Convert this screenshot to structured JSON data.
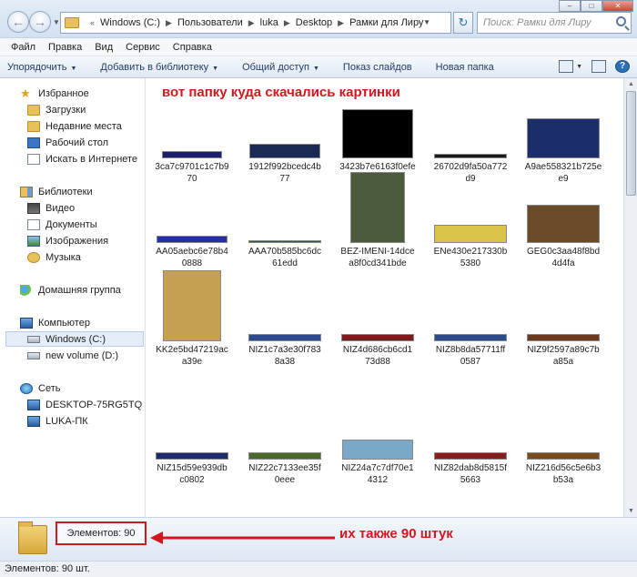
{
  "window": {
    "minimize": "–",
    "maximize": "□",
    "close": "✕"
  },
  "address": {
    "crumbs": [
      "Windows (C:)",
      "Пользователи",
      "luka",
      "Desktop",
      "Рамки для Лиру"
    ],
    "search_placeholder": "Поиск: Рамки для Лиру"
  },
  "menu": [
    "Файл",
    "Правка",
    "Вид",
    "Сервис",
    "Справка"
  ],
  "toolbar": {
    "organize": "Упорядочить",
    "add_library": "Добавить в библиотеку",
    "share": "Общий доступ",
    "slideshow": "Показ слайдов",
    "new_folder": "Новая папка"
  },
  "sidebar": {
    "favorites": "Избранное",
    "favorites_items": [
      "Загрузки",
      "Недавние места",
      "Рабочий стол",
      "Искать в Интернете"
    ],
    "libraries": "Библиотеки",
    "libraries_items": [
      "Видео",
      "Документы",
      "Изображения",
      "Музыка"
    ],
    "homegroup": "Домашняя группа",
    "computer": "Компьютер",
    "computer_items": [
      "Windows (C:)",
      "new volume (D:)"
    ],
    "network": "Сеть",
    "network_items": [
      "DESKTOP-75RG5TQ",
      "LUKA-ПК"
    ]
  },
  "annotation_top": "вот папку куда скачались картинки",
  "files": [
    {
      "l1": "3ca7c9701c1c7b9",
      "l2": "70",
      "color": "#1b1f6e"
    },
    {
      "l1": "1912f992bcedc4b",
      "l2": "77",
      "color": "#1a2a55"
    },
    {
      "l1": "3423b7e6163f0efe",
      "l2": "d",
      "color": "#000000"
    },
    {
      "l1": "26702d9fa50a772",
      "l2": "d9",
      "color": "#1a1a1a"
    },
    {
      "l1": "A9ae558321b725e",
      "l2": "e9",
      "color": "#1c2d6b"
    },
    {
      "l1": "AA05aebc6e78b4",
      "l2": "0888",
      "color": "#2530a0"
    },
    {
      "l1": "AAA70b585bc6dc",
      "l2": "61edd",
      "color": "#2d3fa8"
    },
    {
      "l1": "BEZ-IMENI-14dce",
      "l2": "a8f0cd341bde",
      "color": "#4a5a3a"
    },
    {
      "l1": "ENe430e217330b",
      "l2": "5380",
      "color": "#d9c34a"
    },
    {
      "l1": "GEG0c3aa48f8bd",
      "l2": "4d4fa",
      "color": "#6b4a2a"
    },
    {
      "l1": "KK2e5bd47219ac",
      "l2": "a39e",
      "color": "#c4a050"
    },
    {
      "l1": "NIZ1c7a3e30f783",
      "l2": "8a38",
      "color": "#2c4a8c"
    },
    {
      "l1": "NIZ4d686cb6cd1",
      "l2": "73d88",
      "color": "#7a1c1c"
    },
    {
      "l1": "NIZ8b8da57711ff",
      "l2": "0587",
      "color": "#2a4a8a"
    },
    {
      "l1": "NIZ9f2597a89c7b",
      "l2": "a85a",
      "color": "#6b3a1e"
    },
    {
      "l1": "NIZ15d59e939db",
      "l2": "c0802",
      "color": "#1e2a70"
    },
    {
      "l1": "NIZ22c7133ee35f",
      "l2": "0eee",
      "color": "#4a6a2a"
    },
    {
      "l1": "NIZ24a7c7df70e1",
      "l2": "4312",
      "color": "#7aa8c8"
    },
    {
      "l1": "NIZ82dab8d5815f",
      "l2": "5663",
      "color": "#8a1c1c"
    },
    {
      "l1": "NIZ216d56c5e6b3",
      "l2": "b53a",
      "color": "#7a4a1a"
    }
  ],
  "details": {
    "count": "Элементов: 90",
    "annotation": "их также 90 штук"
  },
  "status": "Элементов: 90 шт."
}
